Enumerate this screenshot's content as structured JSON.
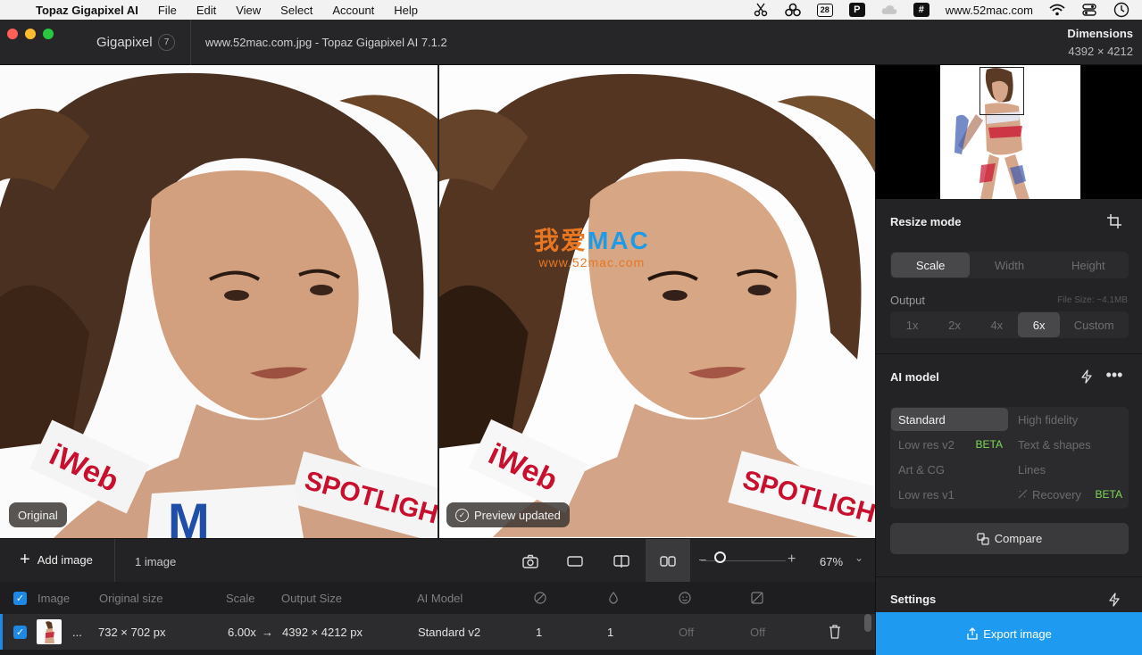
{
  "menubar": {
    "app_name": "Topaz Gigapixel AI",
    "items": [
      "File",
      "Edit",
      "View",
      "Select",
      "Account",
      "Help"
    ],
    "tray_calendar_day": "28",
    "tray_url": "www.52mac.com"
  },
  "titlebar": {
    "product": "Gigapixel",
    "version_badge": "7",
    "window_title": "www.52mac.com.jpg - Topaz Gigapixel AI 7.1.2",
    "dimensions_label": "Dimensions",
    "dimensions_value": "4392 × 4212"
  },
  "preview": {
    "left_label": "Original",
    "right_label": "Preview updated",
    "watermark_cn": "我爱",
    "watermark_mac": "MAC",
    "watermark_url": "www.52mac.com",
    "photo_text_1": "iWeb",
    "photo_text_2": "SPOTLIGHT",
    "photo_text_3": "M"
  },
  "toolbar": {
    "add_image": "Add image",
    "image_count": "1 image",
    "zoom": "67%"
  },
  "table": {
    "headers": [
      "Image",
      "Original size",
      "Scale",
      "Output Size",
      "AI Model"
    ],
    "row": {
      "name": "...",
      "original_size": "732 × 702 px",
      "scale": "6.00x",
      "arrow": "→",
      "output_size": "4392 × 4212 px",
      "ai_model": "Standard v2",
      "col_1": "1",
      "col_2": "1",
      "col_3": "Off",
      "col_4": "Off"
    }
  },
  "side": {
    "resize_mode": "Resize mode",
    "resize_tabs": [
      "Scale",
      "Width",
      "Height"
    ],
    "output_label": "Output",
    "file_size": "File Size: ~4.1MB",
    "scale_options": [
      "1x",
      "2x",
      "4x",
      "6x",
      "Custom"
    ],
    "ai_model_title": "AI model",
    "models": {
      "standard": "Standard",
      "high_fidelity": "High fidelity",
      "low_res_v2": "Low res v2",
      "text_shapes": "Text & shapes",
      "art_cg": "Art & CG",
      "lines": "Lines",
      "low_res_v1": "Low res v1",
      "recovery": "Recovery",
      "beta": "BETA"
    },
    "compare": "Compare",
    "settings": "Settings",
    "export": "Export image"
  }
}
